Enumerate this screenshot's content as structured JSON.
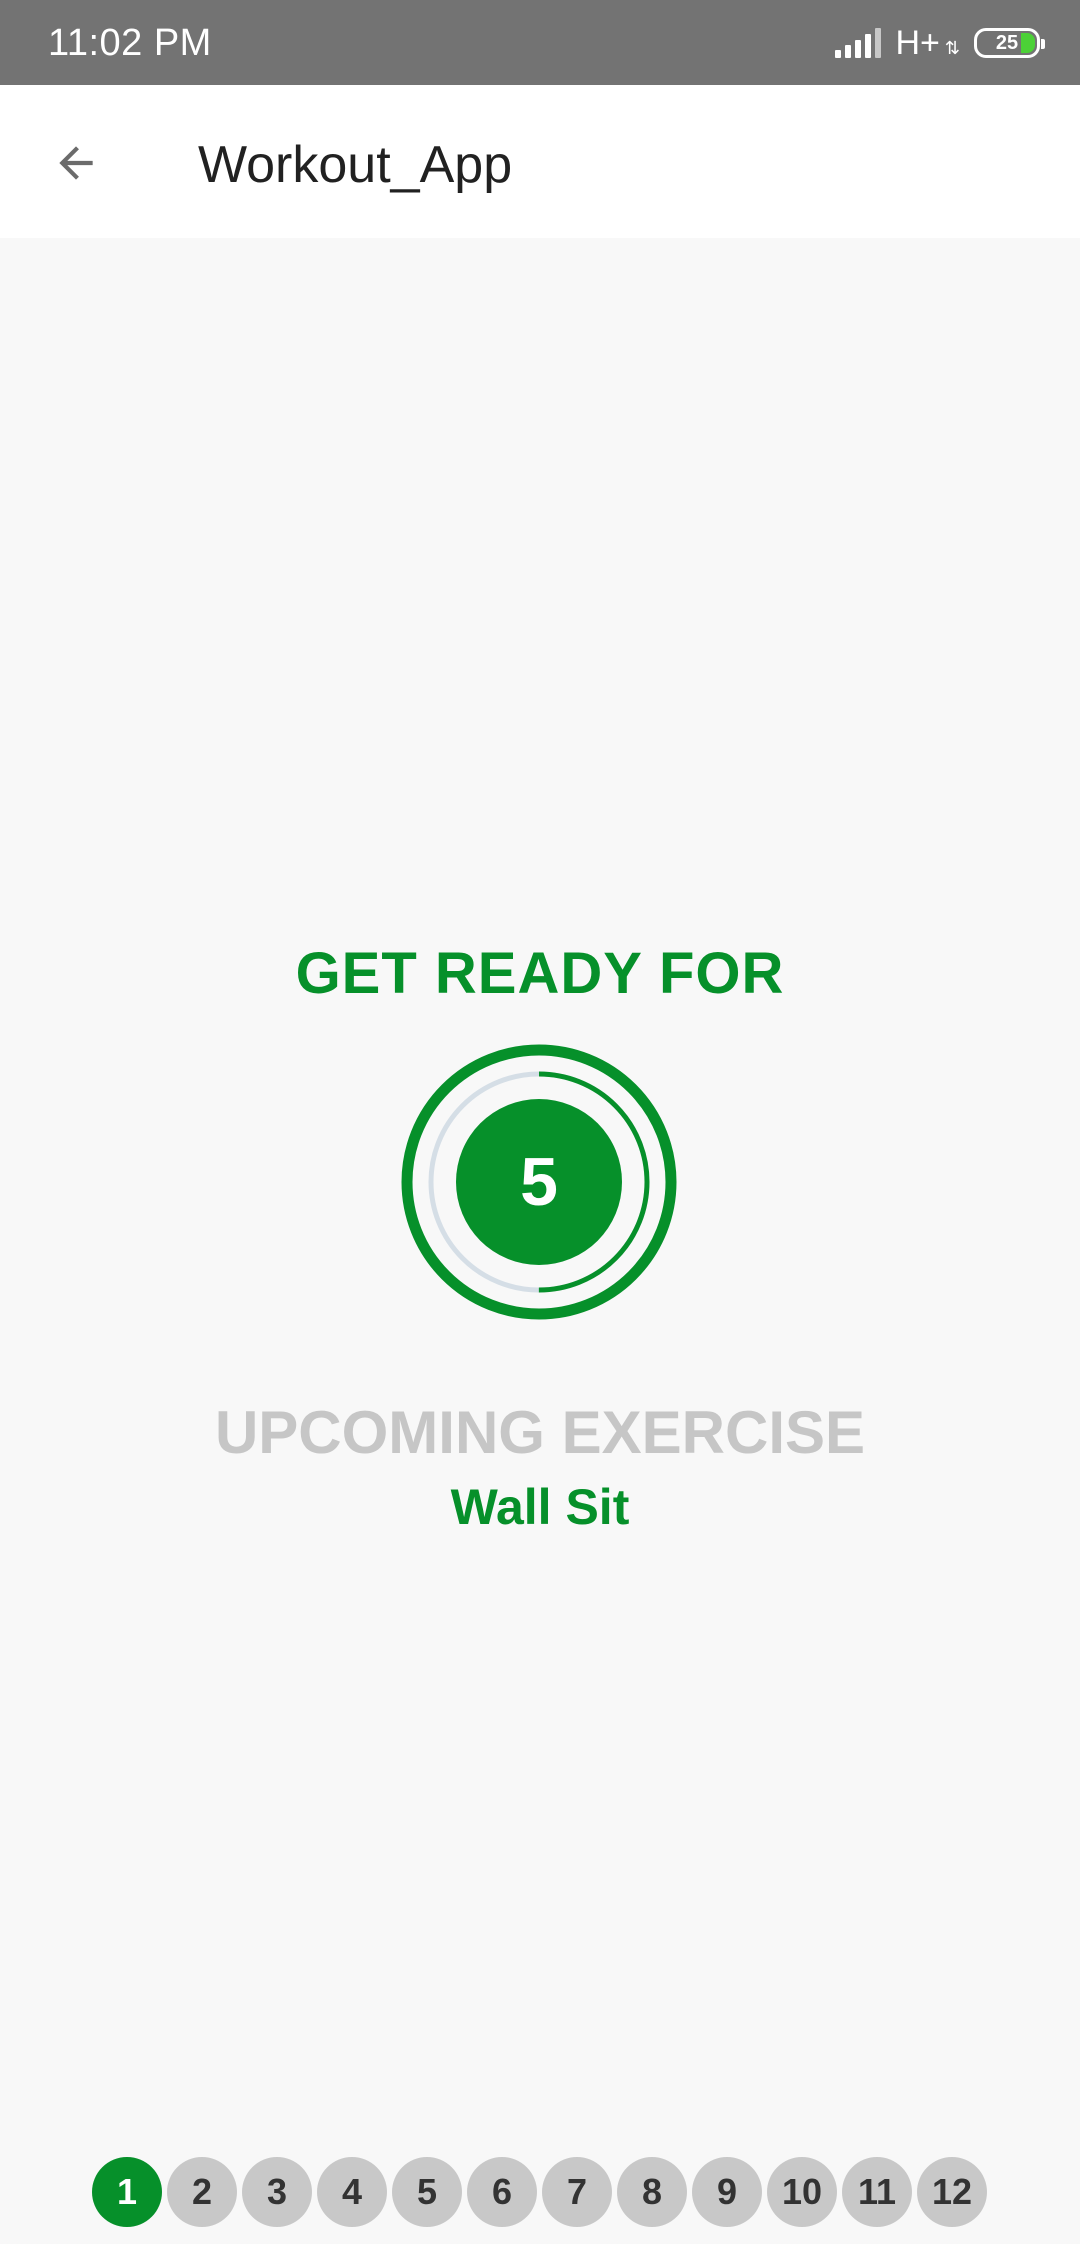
{
  "status_bar": {
    "time": "11:02  PM",
    "network": "H+",
    "battery": "25"
  },
  "app_bar": {
    "title": "Workout_App",
    "back_icon": "arrow-left-icon"
  },
  "ready": {
    "title": "GET READY FOR",
    "countdown": "5",
    "progress_fraction": 0.5
  },
  "upcoming": {
    "label": "UPCOMING EXERCISE",
    "exercise": "Wall Sit"
  },
  "exercise_steps": {
    "active_index": 0,
    "items": [
      "1",
      "2",
      "3",
      "4",
      "5",
      "6",
      "7",
      "8",
      "9",
      "10",
      "11",
      "12"
    ]
  },
  "colors": {
    "accent": "#06902a",
    "status_bar": "#737373",
    "inactive_step": "#c8c8c8",
    "muted_text": "#c6c6c6"
  }
}
